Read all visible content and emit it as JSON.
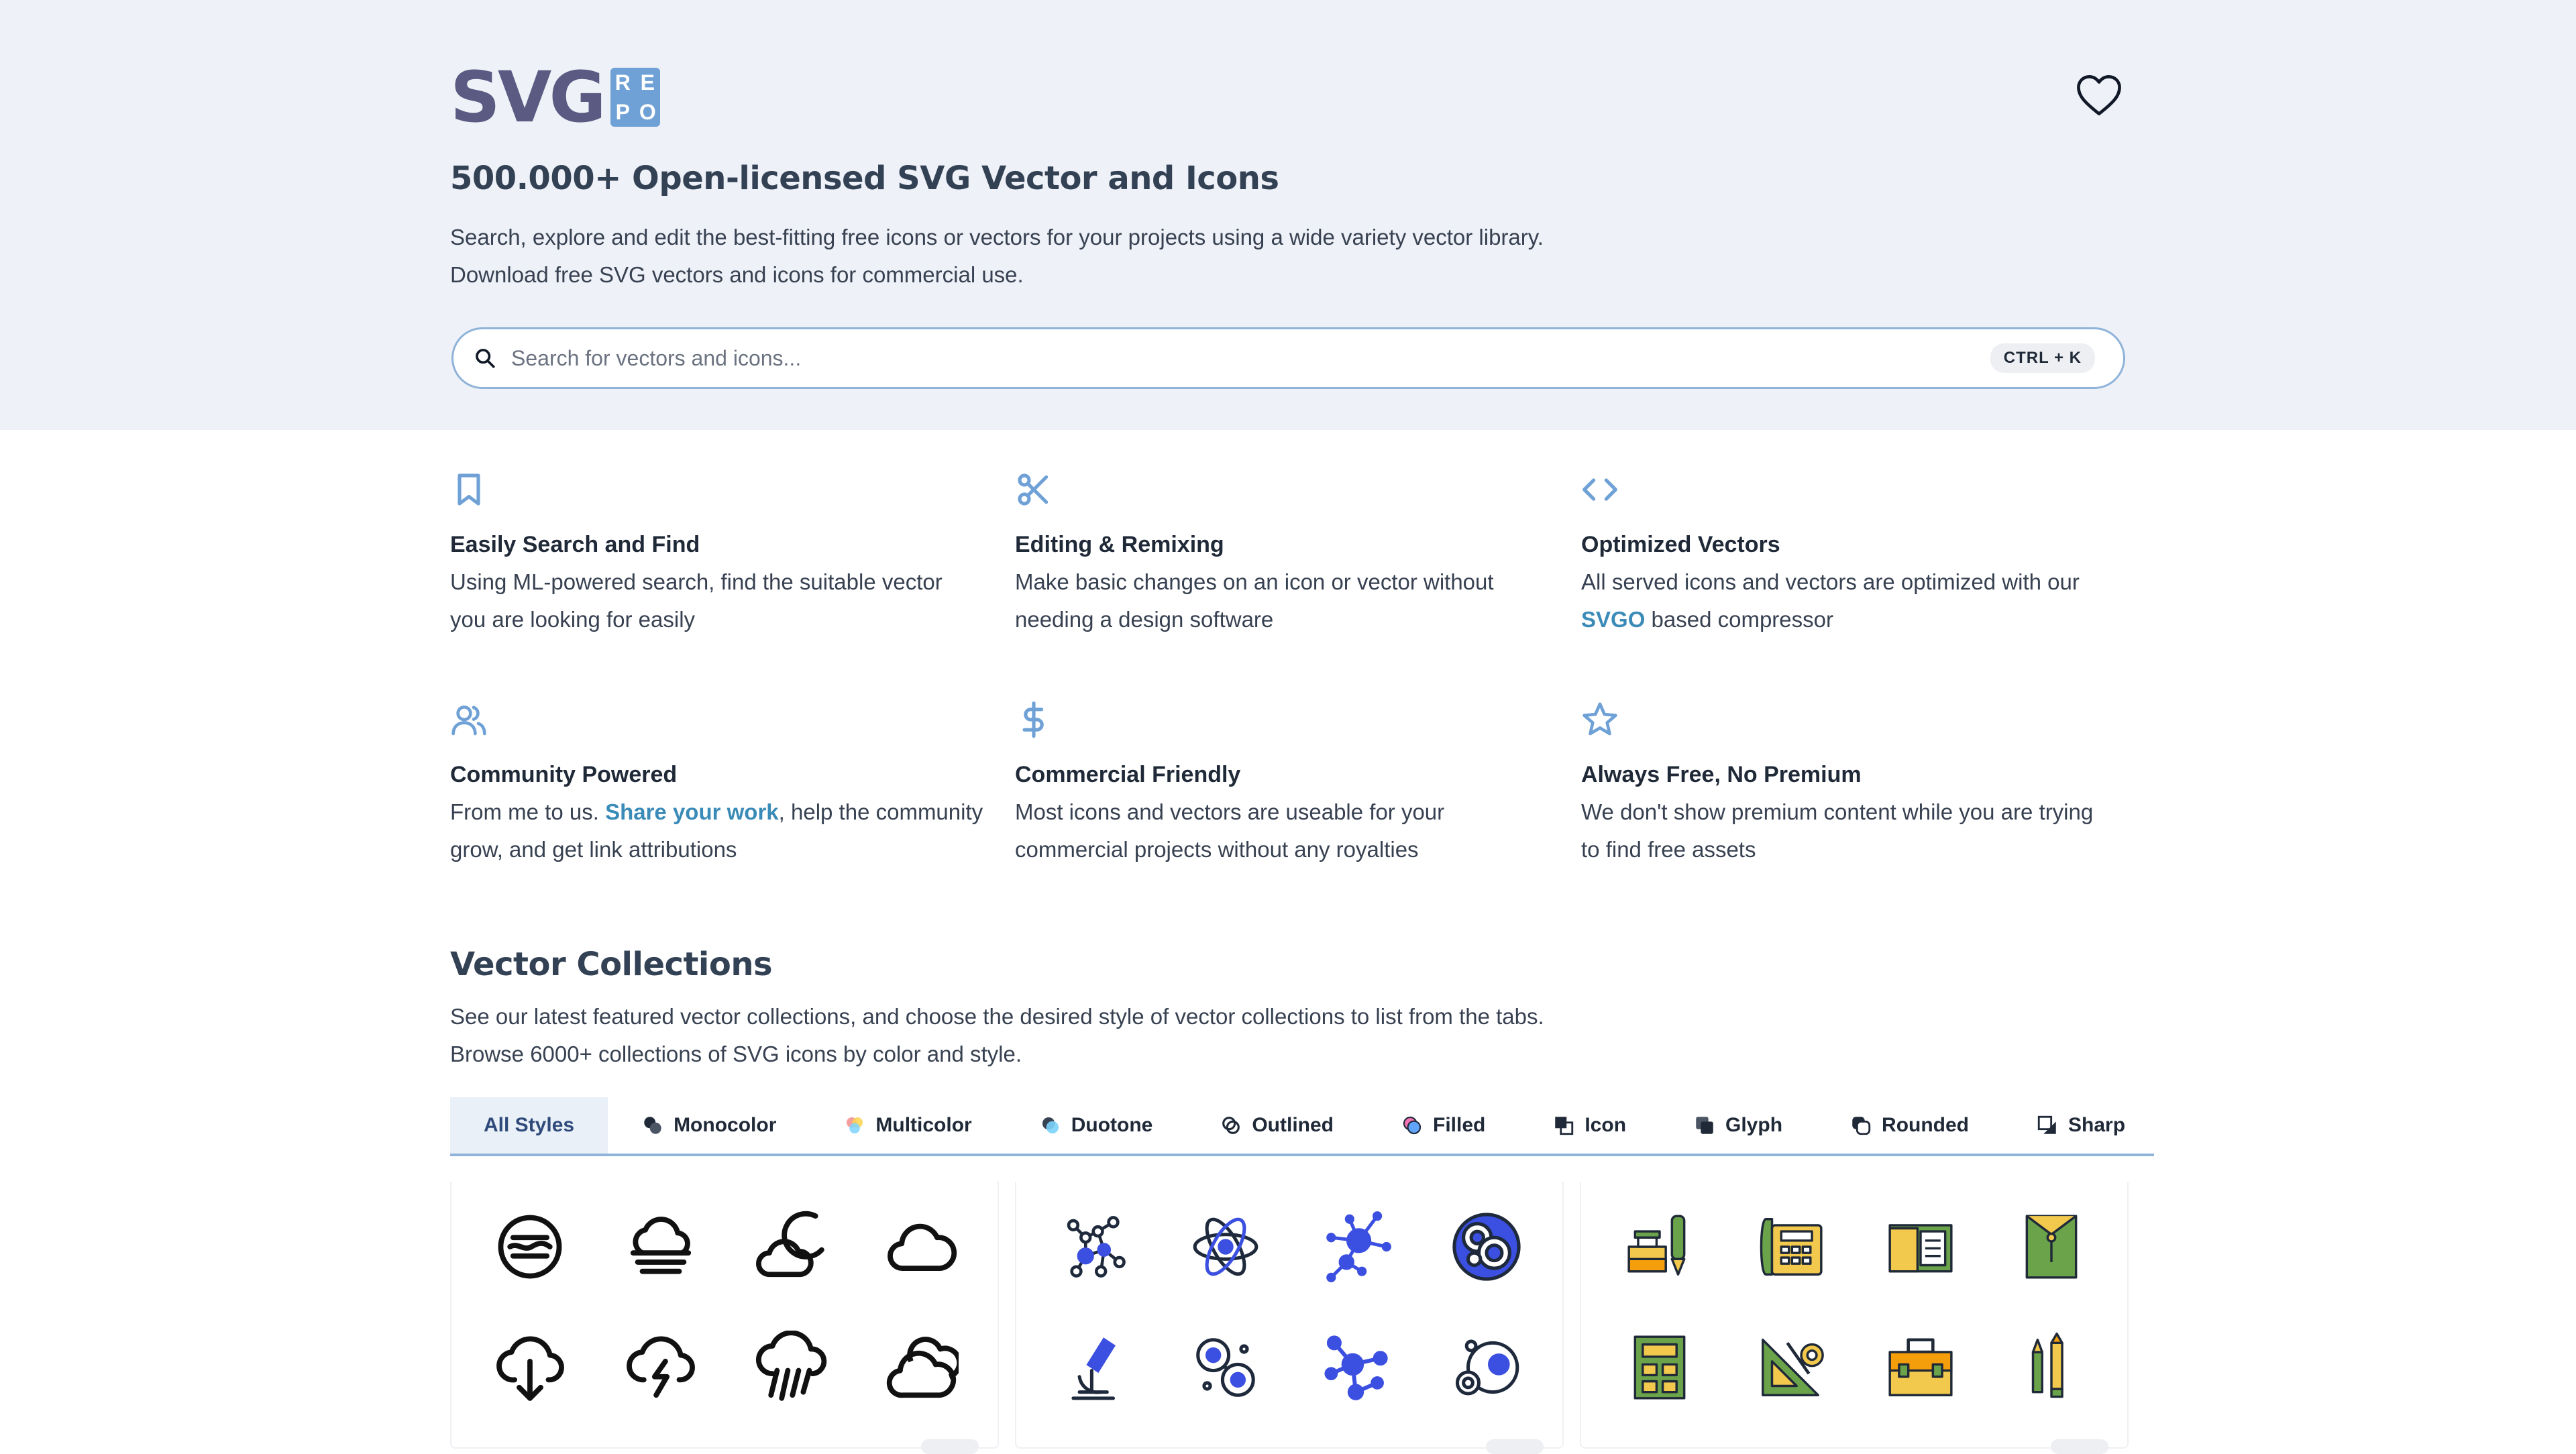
{
  "header": {
    "logo_text": "SVG",
    "logo_badge": [
      "R",
      "E",
      "P",
      "O"
    ],
    "title": "500.000+ Open-licensed SVG Vector and Icons",
    "description_line1": "Search, explore and edit the best-fitting free icons or vectors for your projects using a wide variety vector library.",
    "description_line2": "Download free SVG vectors and icons for commercial use."
  },
  "search": {
    "placeholder": "Search for vectors and icons...",
    "shortcut": "CTRL + K"
  },
  "features": [
    {
      "icon": "bookmark-icon",
      "title": "Easily Search and Find",
      "line1": "Using ML-powered search, find the suitable vector",
      "line2": "you are looking for easily"
    },
    {
      "icon": "scissors-icon",
      "title": "Editing & Remixing",
      "line1": "Make basic changes on an icon or vector without",
      "line2": "needing a design software"
    },
    {
      "icon": "code-icon",
      "title": "Optimized Vectors",
      "line1": "All served icons and vectors are optimized with our",
      "link": "SVGO",
      "line2_rest": " based compressor"
    },
    {
      "icon": "users-icon",
      "title": "Community Powered",
      "line1_pre": "From me to us. ",
      "link": "Share your work",
      "line1_post": ", help the community",
      "line2": "grow, and get link attributions"
    },
    {
      "icon": "dollar-icon",
      "title": "Commercial Friendly",
      "line1": "Most icons and vectors are useable for your",
      "line2": "commercial projects without any royalties"
    },
    {
      "icon": "star-icon",
      "title": "Always Free, No Premium",
      "line1": "We don't show premium content while you are trying",
      "line2": "to find free assets"
    }
  ],
  "collections": {
    "title": "Vector Collections",
    "description_line1": "See our latest featured vector collections, and choose the desired style of vector collections to list from the tabs.",
    "description_line2": "Browse 6000+ collections of SVG icons by color and style.",
    "tabs": [
      {
        "label": "All Styles",
        "icon": "",
        "active": true
      },
      {
        "label": "Monocolor",
        "icon": "monocolor-icon"
      },
      {
        "label": "Multicolor",
        "icon": "multicolor-icon"
      },
      {
        "label": "Duotone",
        "icon": "duotone-icon"
      },
      {
        "label": "Outlined",
        "icon": "outlined-icon"
      },
      {
        "label": "Filled",
        "icon": "filled-icon"
      },
      {
        "label": "Icon",
        "icon": "icon-style-icon"
      },
      {
        "label": "Glyph",
        "icon": "glyph-icon"
      },
      {
        "label": "Rounded",
        "icon": "rounded-icon"
      },
      {
        "label": "Sharp",
        "icon": "sharp-icon"
      }
    ],
    "cards": [
      {
        "theme": "weather",
        "icons": [
          "fog-icon",
          "mist-cloud-icon",
          "moon-cloud-icon",
          "cloud-icon",
          "cloud-download-icon",
          "cloud-lightning-icon",
          "cloud-rain-icon",
          "clouds-icon"
        ]
      },
      {
        "theme": "science",
        "icons": [
          "molecule-icon",
          "atom-icon",
          "network-node-icon",
          "cells-icon",
          "microscope-icon",
          "bacteria-icon",
          "molecule-nodes-icon",
          "cell-division-icon"
        ]
      },
      {
        "theme": "office",
        "icons": [
          "ink-pen-icon",
          "telephone-icon",
          "folder-document-icon",
          "envelope-folder-icon",
          "calculator-icon",
          "drafting-tools-icon",
          "briefcase-icon",
          "pencils-icon"
        ]
      }
    ]
  },
  "colors": {
    "hero_bg": "#eef1f7",
    "accent_blue": "#6fa1d6",
    "link": "#3b8bb8",
    "logo_purple": "#5a5a82",
    "tab_active_bg": "#eaf0f8"
  }
}
